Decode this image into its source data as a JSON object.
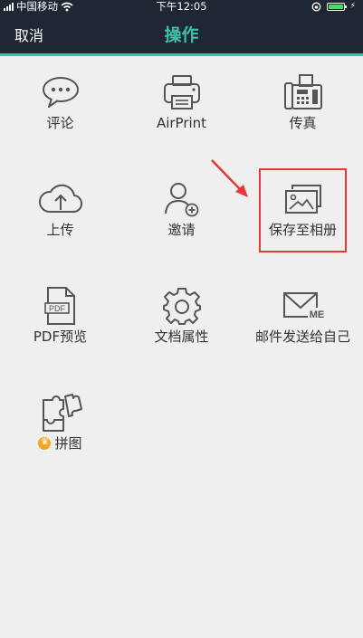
{
  "status_bar": {
    "carrier": "中国移动",
    "time": "下午12:05",
    "battery_percent": 100
  },
  "nav": {
    "cancel_label": "取消",
    "title": "操作",
    "accent_color": "#3fc1a9"
  },
  "actions": [
    {
      "label": "评论",
      "icon": "comment-icon"
    },
    {
      "label": "AirPrint",
      "icon": "printer-icon"
    },
    {
      "label": "传真",
      "icon": "fax-icon"
    },
    {
      "label": "上传",
      "icon": "cloud-upload-icon"
    },
    {
      "label": "邀请",
      "icon": "invite-user-icon"
    },
    {
      "label": "保存至相册",
      "icon": "photo-album-icon"
    },
    {
      "label": "PDF预览",
      "icon": "pdf-file-icon"
    },
    {
      "label": "文档属性",
      "icon": "gear-icon"
    },
    {
      "label": "邮件发送给自己",
      "icon": "mail-me-icon"
    },
    {
      "label": "拼图",
      "icon": "puzzle-icon",
      "badge": "crown-icon"
    }
  ],
  "annotation": {
    "highlight_color": "#e53935"
  }
}
